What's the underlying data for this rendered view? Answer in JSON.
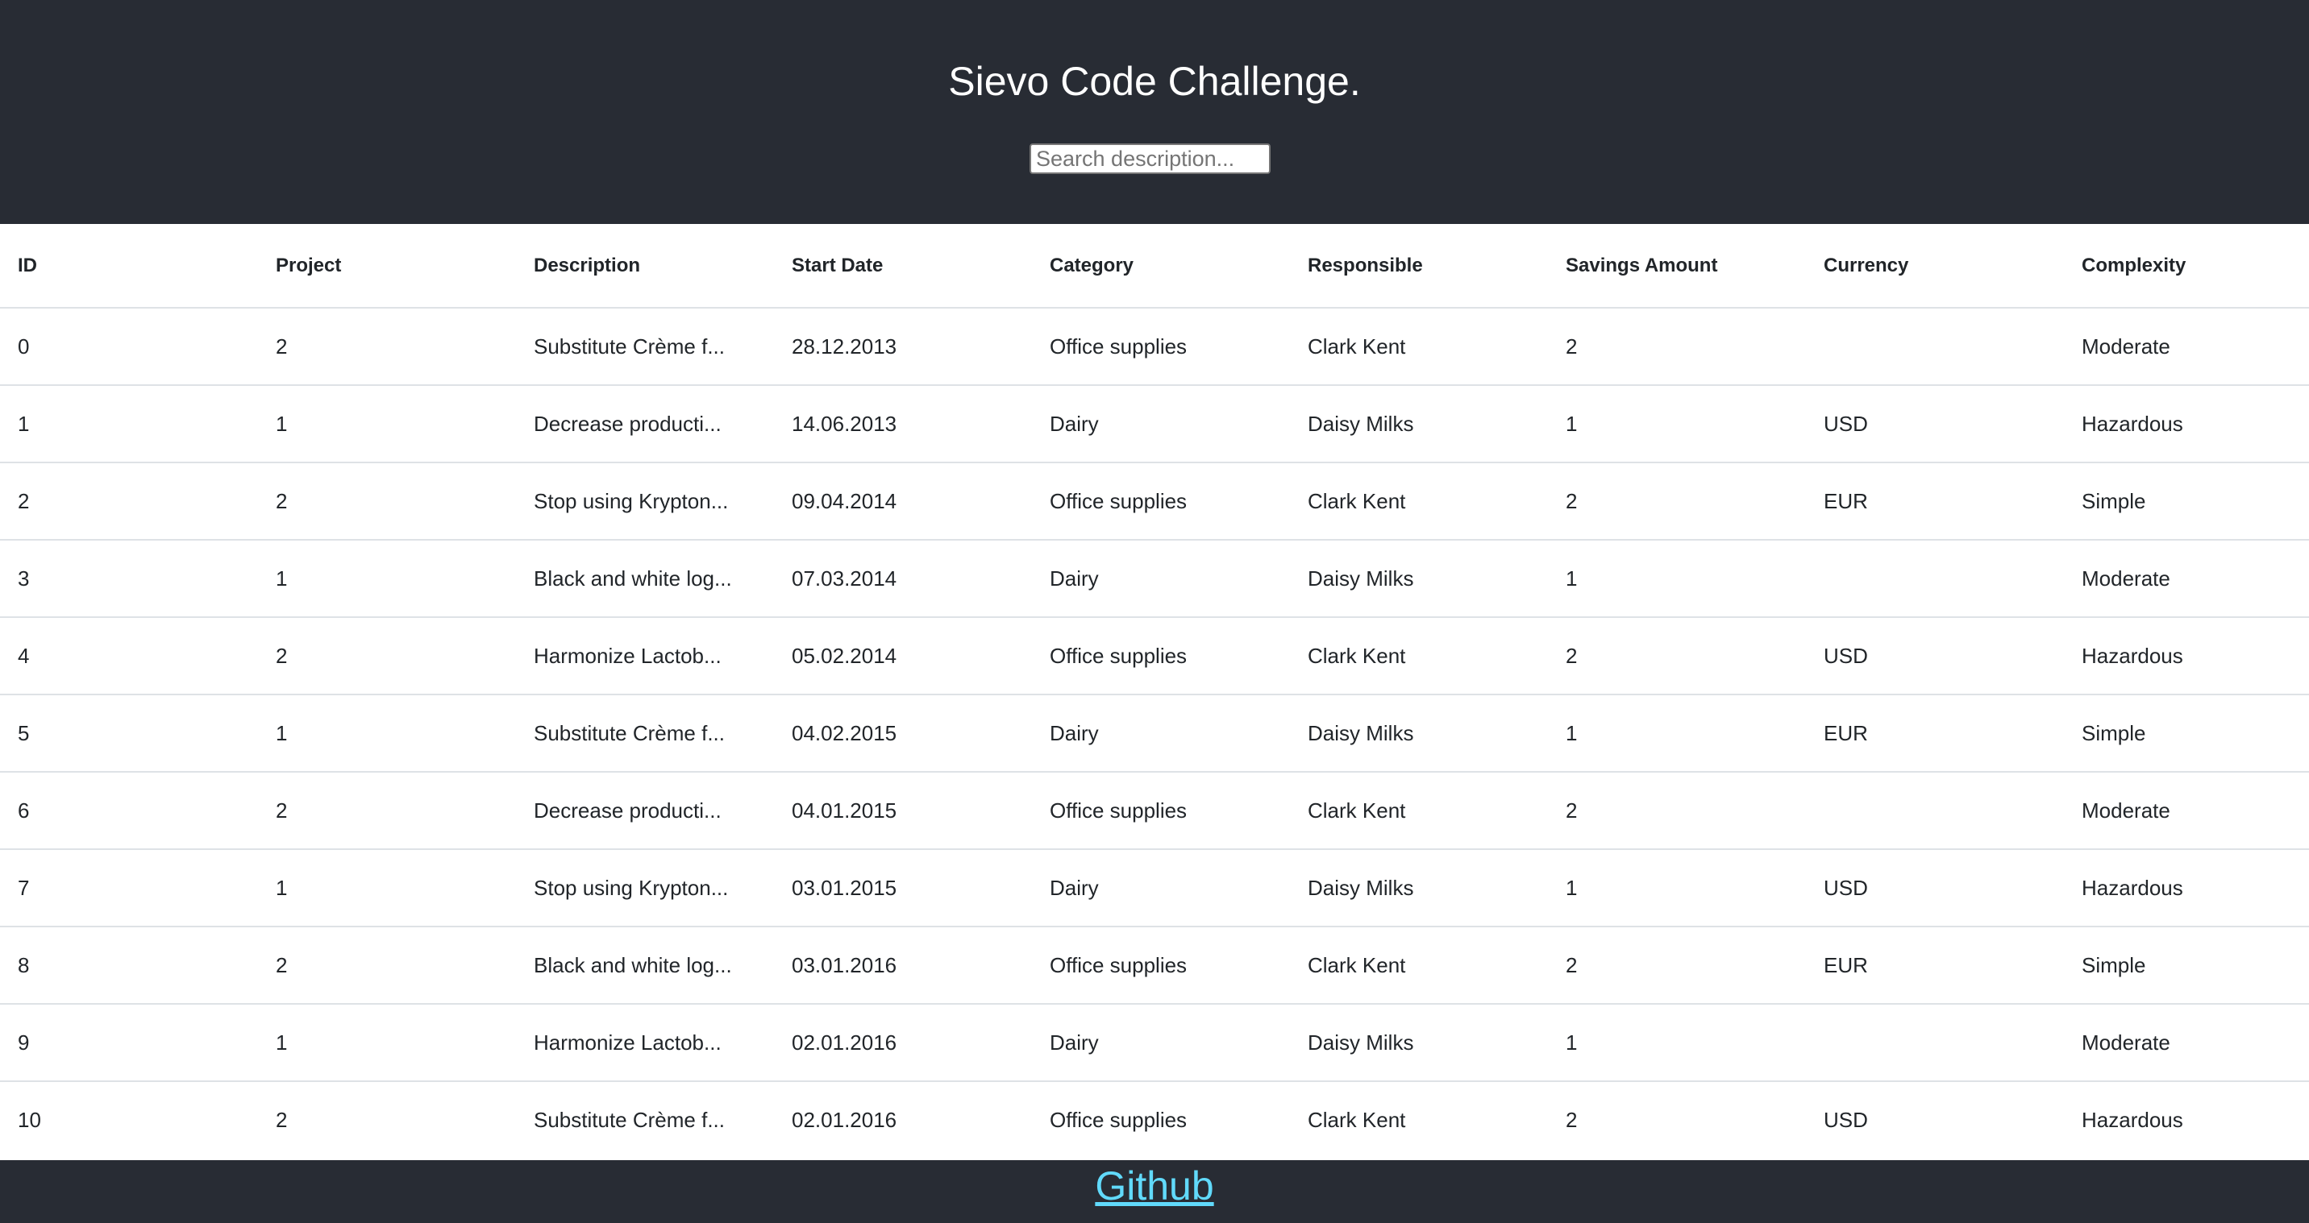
{
  "header": {
    "title": "Sievo Code Challenge.",
    "search_placeholder": "Search description..."
  },
  "table": {
    "columns": [
      "ID",
      "Project",
      "Description",
      "Start Date",
      "Category",
      "Responsible",
      "Savings Amount",
      "Currency",
      "Complexity"
    ],
    "rows": [
      [
        "0",
        "2",
        "Substitute Crème f...",
        "28.12.2013",
        "Office supplies",
        "Clark Kent",
        "2",
        "",
        "Moderate"
      ],
      [
        "1",
        "1",
        "Decrease producti...",
        "14.06.2013",
        "Dairy",
        "Daisy Milks",
        "1",
        "USD",
        "Hazardous"
      ],
      [
        "2",
        "2",
        "Stop using Krypton...",
        "09.04.2014",
        "Office supplies",
        "Clark Kent",
        "2",
        "EUR",
        "Simple"
      ],
      [
        "3",
        "1",
        "Black and white log...",
        "07.03.2014",
        "Dairy",
        "Daisy Milks",
        "1",
        "",
        "Moderate"
      ],
      [
        "4",
        "2",
        "Harmonize Lactob...",
        "05.02.2014",
        "Office supplies",
        "Clark Kent",
        "2",
        "USD",
        "Hazardous"
      ],
      [
        "5",
        "1",
        "Substitute Crème f...",
        "04.02.2015",
        "Dairy",
        "Daisy Milks",
        "1",
        "EUR",
        "Simple"
      ],
      [
        "6",
        "2",
        "Decrease producti...",
        "04.01.2015",
        "Office supplies",
        "Clark Kent",
        "2",
        "",
        "Moderate"
      ],
      [
        "7",
        "1",
        "Stop using Krypton...",
        "03.01.2015",
        "Dairy",
        "Daisy Milks",
        "1",
        "USD",
        "Hazardous"
      ],
      [
        "8",
        "2",
        "Black and white log...",
        "03.01.2016",
        "Office supplies",
        "Clark Kent",
        "2",
        "EUR",
        "Simple"
      ],
      [
        "9",
        "1",
        "Harmonize Lactob...",
        "02.01.2016",
        "Dairy",
        "Daisy Milks",
        "1",
        "",
        "Moderate"
      ],
      [
        "10",
        "2",
        "Substitute Crème f...",
        "02.01.2016",
        "Office supplies",
        "Clark Kent",
        "2",
        "USD",
        "Hazardous"
      ]
    ]
  },
  "footer": {
    "link_label": "Github"
  },
  "colors": {
    "header_bg": "#282c34",
    "link": "#61dafb"
  }
}
